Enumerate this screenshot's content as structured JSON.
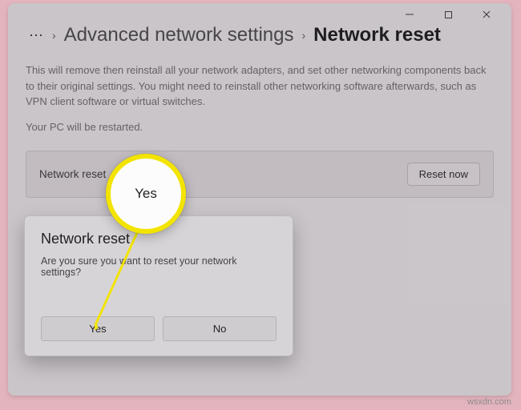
{
  "breadcrumb": {
    "parent": "Advanced network settings",
    "current": "Network reset"
  },
  "page": {
    "description": "This will remove then reinstall all your network adapters, and set other networking components back to their original settings. You might need to reinstall other networking software afterwards, such as VPN client software or virtual switches.",
    "restart_note": "Your PC will be restarted."
  },
  "card": {
    "label": "Network reset",
    "button": "Reset now"
  },
  "dialog": {
    "title": "Network reset",
    "message": "Are you sure you want to reset your network settings?",
    "yes": "Yes",
    "no": "No"
  },
  "callout": {
    "label": "Yes"
  },
  "watermark": "wsxdn.com"
}
